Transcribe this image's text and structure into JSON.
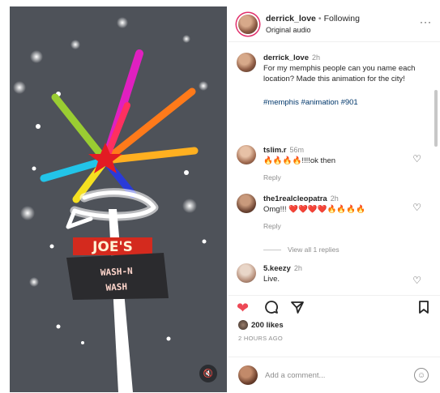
{
  "post": {
    "author": "derrick_love",
    "separator": "•",
    "follow_status": "Following",
    "audio": "Original audio",
    "more_icon": "more-horizontal-icon"
  },
  "media": {
    "sign_top": "JOE'S",
    "sign_bottom_1": "WASH-N",
    "sign_bottom_2": "WASH",
    "mute_icon": "speaker-muted-icon",
    "background_color": "#4e5259"
  },
  "caption": {
    "username": "derrick_love",
    "time": "2h",
    "text": "For my memphis people can you name each location? Made this animation for the city!",
    "hashtags": "#memphis #animation #901"
  },
  "comments": [
    {
      "username": "tslim.r",
      "time": "56m",
      "text": "🔥🔥🔥🔥!!!!ok then",
      "reply": "Reply"
    },
    {
      "username": "the1realcleopatra",
      "time": "2h",
      "text": "Omg!!! ❤️❤️❤️❤️🔥🔥🔥🔥",
      "reply": "Reply"
    },
    {
      "username": "5.keezy",
      "time": "2h",
      "text": "Live."
    }
  ],
  "view_replies": "View all 1 replies",
  "actions": {
    "like_icon": "heart-filled-icon",
    "comment_icon": "comment-bubble-icon",
    "share_icon": "paper-plane-icon",
    "save_icon": "bookmark-icon"
  },
  "likes": "200 likes",
  "posted": "2 HOURS AGO",
  "add_comment": {
    "placeholder": "Add a comment..."
  },
  "colors": {
    "like_red": "#ed4956",
    "link_blue": "#00376b",
    "muted_gray": "#8e8e8e"
  }
}
